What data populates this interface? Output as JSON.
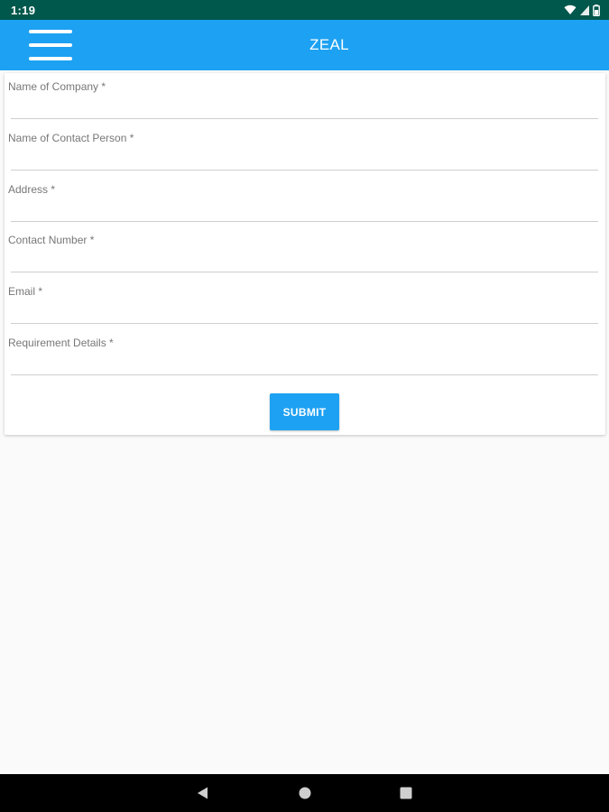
{
  "status_bar": {
    "time": "1:19",
    "icons": [
      "wifi-icon",
      "cell-signal-icon",
      "battery-icon"
    ],
    "background": "#00574b"
  },
  "app_bar": {
    "title": "ZEAL",
    "menu_icon": "hamburger-menu-icon",
    "background": "#1da1f2"
  },
  "form": {
    "fields": [
      {
        "label": "Name of Company *",
        "value": ""
      },
      {
        "label": "Name of Contact Person *",
        "value": ""
      },
      {
        "label": "Address *",
        "value": ""
      },
      {
        "label": "Contact Number *",
        "value": ""
      },
      {
        "label": "Email *",
        "value": ""
      },
      {
        "label": "Requirement Details *",
        "value": ""
      }
    ],
    "submit_label": "SUBMIT"
  },
  "nav_bar": {
    "buttons": [
      "back-icon",
      "home-icon",
      "recents-icon"
    ]
  }
}
